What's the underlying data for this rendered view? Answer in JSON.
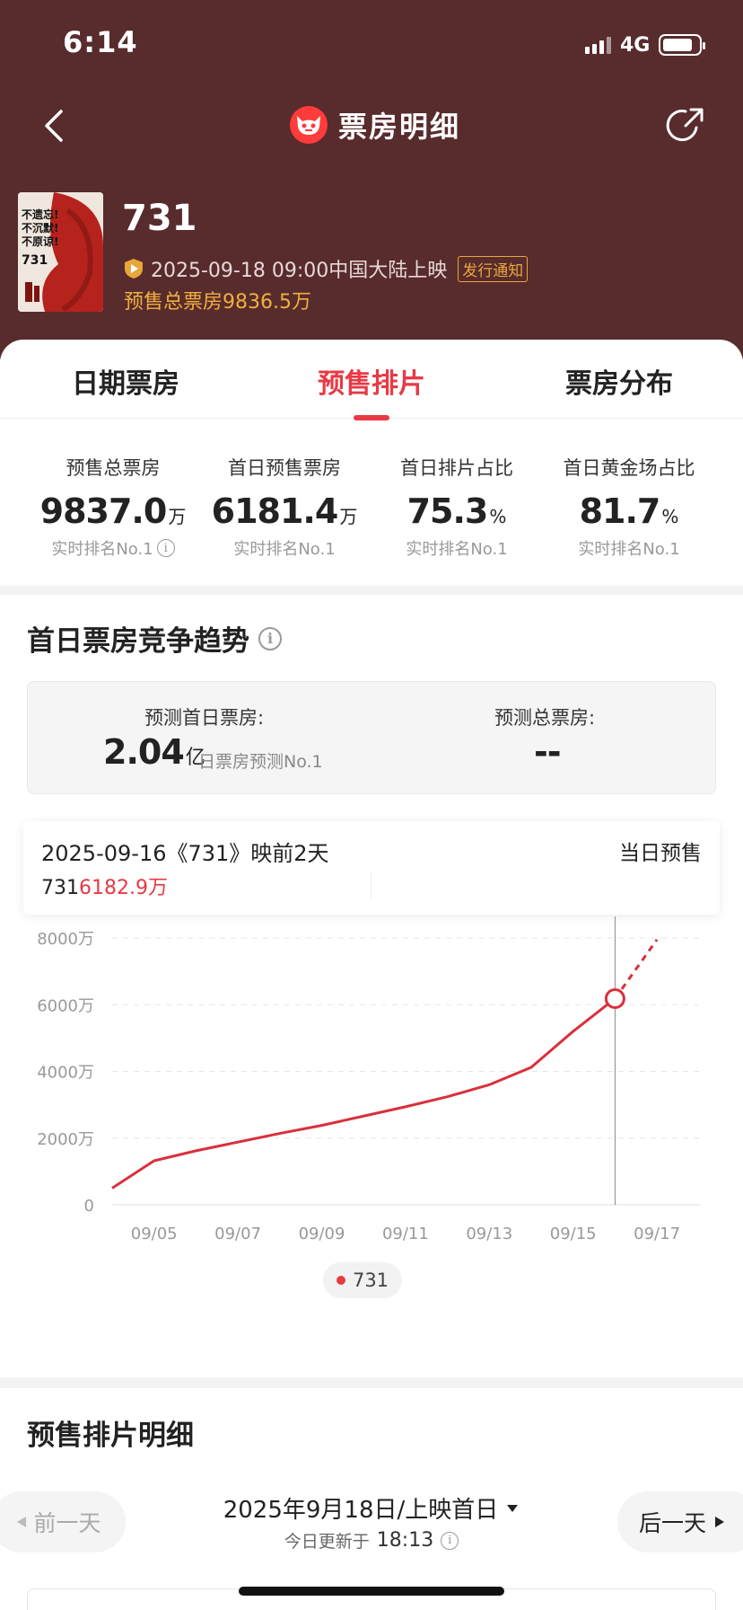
{
  "status_bar": {
    "time": "6:14",
    "network": "4G"
  },
  "nav": {
    "title": "票房明细",
    "back_icon": "chevron-left-icon",
    "share_icon": "share-icon",
    "logo_icon": "maoyan-cat-logo"
  },
  "movie": {
    "title": "731",
    "release": "2025-09-18 09:00中国大陆上映",
    "release_badge": "发行通知",
    "presale_total": "预售总票房9836.5万",
    "poster_text": [
      "不遗忘!",
      "不沉默!",
      "不原谅!",
      "731"
    ]
  },
  "tabs": [
    {
      "label": "日期票房",
      "active": false
    },
    {
      "label": "预售排片",
      "active": true
    },
    {
      "label": "票房分布",
      "active": false
    }
  ],
  "stats": [
    {
      "label": "预售总票房",
      "value": "9837.0",
      "unit": "万",
      "rank": "实时排名No.1"
    },
    {
      "label": "首日预售票房",
      "value": "6181.4",
      "unit": "万",
      "rank": "实时排名No.1"
    },
    {
      "label": "首日排片占比",
      "value": "75.3",
      "unit": "%",
      "rank": "实时排名No.1"
    },
    {
      "label": "首日黄金场占比",
      "value": "81.7",
      "unit": "%",
      "rank": "实时排名No.1"
    }
  ],
  "trend": {
    "title": "首日票房竞争趋势",
    "predict_first_day_label": "预测首日票房:",
    "predict_first_day_value": "2.04",
    "predict_first_day_unit": "亿",
    "predict_first_day_rank": "日票房预测No.1",
    "predict_total_label": "预测总票房:",
    "predict_total_value": "--",
    "tooltip_date": "2025-09-16《731》映前2天",
    "tooltip_mode": "当日预售",
    "tooltip_series": "731",
    "tooltip_value": "6182.9万",
    "legend": "731"
  },
  "chart_data": {
    "type": "line",
    "x": [
      "09/04",
      "09/05",
      "09/06",
      "09/07",
      "09/08",
      "09/09",
      "09/10",
      "09/11",
      "09/12",
      "09/13",
      "09/14",
      "09/15",
      "09/16",
      "09/17"
    ],
    "x_tick_labels": [
      "09/05",
      "09/07",
      "09/09",
      "09/11",
      "09/13",
      "09/15",
      "09/17"
    ],
    "y_tick_labels": [
      "0",
      "2000万",
      "4000万",
      "6000万",
      "8000万"
    ],
    "ylim": [
      0,
      8000
    ],
    "series": [
      {
        "name": "731",
        "values": [
          500,
          1320,
          1620,
          1880,
          2140,
          2380,
          2660,
          2940,
          3240,
          3600,
          4120,
          5200,
          6182.9,
          7950
        ],
        "projected_from_index": 12
      }
    ],
    "highlight_index": 12,
    "color": "#d9303c",
    "grid": true
  },
  "detail": {
    "title": "预售排片明细",
    "prev_label": "前一天",
    "next_label": "后一天",
    "date": "2025年9月18日/上映首日",
    "updated_label": "今日更新于",
    "updated_time": "18:13"
  }
}
